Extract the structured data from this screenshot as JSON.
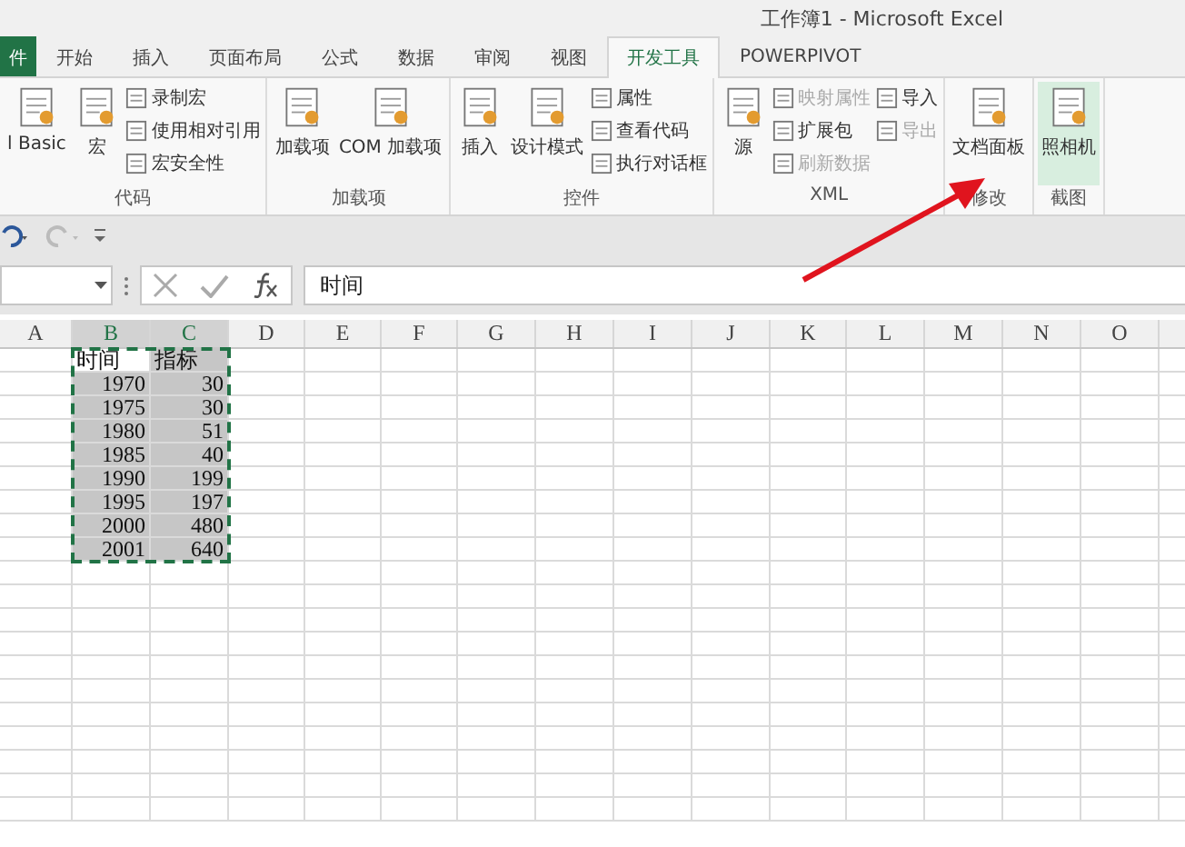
{
  "window": {
    "title": "工作簿1 - Microsoft Excel"
  },
  "tabs": [
    {
      "label": "件",
      "kind": "file",
      "selected": false
    },
    {
      "label": "开始",
      "kind": "tab",
      "selected": false
    },
    {
      "label": "插入",
      "kind": "tab",
      "selected": false
    },
    {
      "label": "页面布局",
      "kind": "tab",
      "selected": false
    },
    {
      "label": "公式",
      "kind": "tab",
      "selected": false
    },
    {
      "label": "数据",
      "kind": "tab",
      "selected": false
    },
    {
      "label": "审阅",
      "kind": "tab",
      "selected": false
    },
    {
      "label": "视图",
      "kind": "tab",
      "selected": false
    },
    {
      "label": "开发工具",
      "kind": "tab",
      "selected": true
    },
    {
      "label": "POWERPIVOT",
      "kind": "tab",
      "selected": false
    }
  ],
  "ribbon": {
    "groups": [
      {
        "label": "代码",
        "large": [
          {
            "label": "l Basic",
            "highlighted": false
          },
          {
            "label": "宏",
            "highlighted": false
          }
        ],
        "small": [
          {
            "label": "录制宏",
            "disabled": false
          },
          {
            "label": "使用相对引用",
            "disabled": false
          },
          {
            "label": "宏安全性",
            "disabled": false
          }
        ]
      },
      {
        "label": "加载项",
        "large": [
          {
            "label": "加载项",
            "highlighted": false
          },
          {
            "label": "COM 加载项",
            "highlighted": false
          }
        ]
      },
      {
        "label": "控件",
        "large": [
          {
            "label": "插入",
            "highlighted": false
          },
          {
            "label": "设计模式",
            "highlighted": false
          }
        ],
        "small": [
          {
            "label": "属性",
            "disabled": false
          },
          {
            "label": "查看代码",
            "disabled": false
          },
          {
            "label": "执行对话框",
            "disabled": false
          }
        ]
      },
      {
        "label": "XML",
        "large": [
          {
            "label": "源",
            "highlighted": false
          }
        ],
        "small": [
          {
            "label": "映射属性",
            "disabled": true
          },
          {
            "label": "扩展包",
            "disabled": false
          },
          {
            "label": "刷新数据",
            "disabled": true
          },
          {
            "label": "导入",
            "disabled": false
          },
          {
            "label": "导出",
            "disabled": true
          }
        ]
      },
      {
        "label": "修改",
        "large": [
          {
            "label": "文档面板",
            "highlighted": false
          }
        ]
      },
      {
        "label": "截图",
        "large": [
          {
            "label": "照相机",
            "highlighted": true
          }
        ]
      }
    ]
  },
  "formula_bar": {
    "value": "时间"
  },
  "sheet": {
    "columns": [
      {
        "label": "A",
        "selected": false
      },
      {
        "label": "B",
        "selected": true
      },
      {
        "label": "C",
        "selected": true
      },
      {
        "label": "D",
        "selected": false
      },
      {
        "label": "E",
        "selected": false
      },
      {
        "label": "F",
        "selected": false
      },
      {
        "label": "G",
        "selected": false
      },
      {
        "label": "H",
        "selected": false
      },
      {
        "label": "I",
        "selected": false
      },
      {
        "label": "J",
        "selected": false
      },
      {
        "label": "K",
        "selected": false
      },
      {
        "label": "L",
        "selected": false
      },
      {
        "label": "M",
        "selected": false
      },
      {
        "label": "N",
        "selected": false
      },
      {
        "label": "O",
        "selected": false
      }
    ],
    "rows": [
      [
        "",
        "时间",
        "指标"
      ],
      [
        "",
        "1970",
        "30"
      ],
      [
        "",
        "1975",
        "30"
      ],
      [
        "",
        "1980",
        "51"
      ],
      [
        "",
        "1985",
        "40"
      ],
      [
        "",
        "1990",
        "199"
      ],
      [
        "",
        "1995",
        "197"
      ],
      [
        "",
        "2000",
        "480"
      ],
      [
        "",
        "2001",
        "640"
      ]
    ],
    "copy_marquee": true
  }
}
